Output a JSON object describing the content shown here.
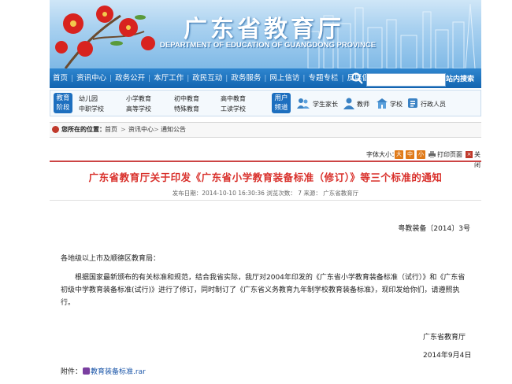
{
  "header": {
    "title": "广东省教育厅",
    "subtitle": "DEPARTMENT OF EDUCATION OF GUANGDONG PROVINCE"
  },
  "nav": {
    "items": [
      "首页",
      "资讯中心",
      "政务公开",
      "本厅工作",
      "政民互动",
      "政务服务",
      "网上信访",
      "专题专栏",
      "反腐倡廉"
    ],
    "search_button": "站内搜索",
    "search_icon": "search-icon"
  },
  "categories": {
    "stage_badge": [
      "教育",
      "阶段"
    ],
    "stage_links": [
      "幼儿园",
      "小学教育",
      "初中教育",
      "高中教育",
      "中职学校",
      "高等学校",
      "特殊教育",
      "工读学校"
    ],
    "user_badge": [
      "用户",
      "频道"
    ],
    "user_links": [
      {
        "label": "学生家长",
        "icon": "parents-icon"
      },
      {
        "label": "教师",
        "icon": "teacher-icon"
      },
      {
        "label": "学校",
        "icon": "school-icon"
      },
      {
        "label": "行政人员",
        "icon": "admin-icon"
      }
    ]
  },
  "breadcrumb": {
    "label": "您所在的位置：",
    "items": [
      "首页",
      "资讯中心",
      "通知公告"
    ],
    "separator": ">"
  },
  "tools": {
    "font_size_label": "字体大小：",
    "sizes": [
      "大",
      "中",
      "小"
    ],
    "print": "打印页面",
    "close": "关闭"
  },
  "article": {
    "title": "广东省教育厅关于印发《广东省小学教育装备标准（修订）》等三个标准的通知",
    "meta": "发布日期：2014-10-10 16:30:36   浏览次数：   7   来源：   广东省教育厅",
    "doc_number": "粤教装备〔2014〕3号",
    "addressee": "各地级以上市及顺德区教育局：",
    "body": "根据国家最新颁布的有关标准和规范，结合我省实际，我厅对2004年印发的《广东省小学教育装备标准（试行）》和《广东省初级中学教育装备标准(试行)》进行了修订，同时制订了《广东省义务教育九年制学校教育装备标准》，现印发给你们，请遵照执行。",
    "signer": "广东省教育厅",
    "date": "2014年9月4日",
    "attachment_label": "附件：",
    "attachment_file": "教育装备标准.rar"
  },
  "colors": {
    "nav_blue": "#1264b0",
    "title_red": "#d9302b",
    "accent_orange": "#e07b1a"
  }
}
